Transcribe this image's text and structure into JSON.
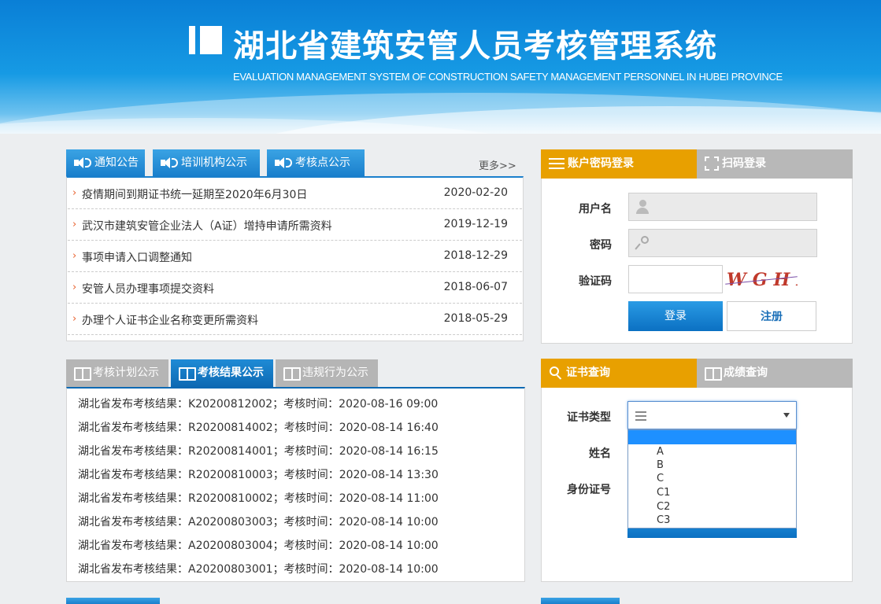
{
  "header": {
    "title": "湖北省建筑安管人员考核管理系统",
    "subtitle": "EVALUATION MANAGEMENT SYSTEM OF CONSTRUCTION SAFETY MANAGEMENT PERSONNEL IN HUBEI PROVINCE"
  },
  "news": {
    "tabs": [
      "通知公告",
      "培训机构公示",
      "考核点公示"
    ],
    "more": "更多>>",
    "items": [
      {
        "title": "疫情期间到期证书统一延期至2020年6月30日",
        "date": "2020-02-20"
      },
      {
        "title": "武汉市建筑安管企业法人（A证）增持申请所需资料",
        "date": "2019-12-19"
      },
      {
        "title": "事项申请入口调整通知",
        "date": "2018-12-29"
      },
      {
        "title": "安管人员办理事项提交资料",
        "date": "2018-06-07"
      },
      {
        "title": "办理个人证书企业名称变更所需资料",
        "date": "2018-05-29"
      }
    ]
  },
  "results": {
    "tabs": [
      "考核计划公示",
      "考核结果公示",
      "违规行为公示"
    ],
    "active_tab": "考核结果公示",
    "items": [
      "湖北省发布考核结果：K20200812002；考核时间：2020-08-16 09:00",
      "湖北省发布考核结果：R20200814002；考核时间：2020-08-14 16:40",
      "湖北省发布考核结果：R20200814001；考核时间：2020-08-14 16:15",
      "湖北省发布考核结果：R20200810003；考核时间：2020-08-14 13:30",
      "湖北省发布考核结果：R20200810002；考核时间：2020-08-14 11:00",
      "湖北省发布考核结果：A20200803003；考核时间：2020-08-14 10:00",
      "湖北省发布考核结果：A20200803004；考核时间：2020-08-14 10:00",
      "湖北省发布考核结果：A20200803001；考核时间：2020-08-14 10:00"
    ]
  },
  "login": {
    "tab_password": "账户密码登录",
    "tab_scan": "扫码登录",
    "username_label": "用户名",
    "password_label": "密码",
    "captcha_label": "验证码",
    "captcha_text": "WGHI",
    "login_button": "登录",
    "register_button": "注册"
  },
  "query": {
    "tab_cert": "证书查询",
    "tab_score": "成绩查询",
    "cert_type_label": "证书类型",
    "name_label": "姓名",
    "id_label": "身份证号",
    "dropdown_options": [
      "A",
      "B",
      "C",
      "C1",
      "C2",
      "C3"
    ]
  },
  "colors": {
    "header_blue": "#169ae4",
    "tab_blue": "#1a7fcc",
    "tab_orange": "#e8a000",
    "arrow_orange": "#e8602c"
  }
}
